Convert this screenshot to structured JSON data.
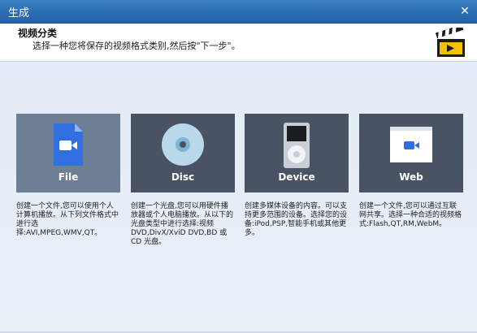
{
  "window": {
    "title": "生成",
    "close_glyph": "✕"
  },
  "header": {
    "title": "视频分类",
    "description": "选择一种您将保存的视频格式类别,然后按\"下一步\"。",
    "logo_icon": "clapperboard-icon"
  },
  "options": [
    {
      "label": "File",
      "icon": "file-video-icon",
      "selected": true,
      "description": "创建一个文件,您可以使用个人计算机播放。从下列文件格式中进行选择:AVI,MPEG,WMV,QT。"
    },
    {
      "label": "Disc",
      "icon": "disc-icon",
      "selected": false,
      "description": "创建一个光盘,您可以用硬件播放器或个人电脑播放。从以下的光盘类型中进行选择:视频 DVD,DivX/XviD DVD,BD 或 CD 光盘。"
    },
    {
      "label": "Device",
      "icon": "media-player-icon",
      "selected": false,
      "description": "创建多媒体设备的内容。可以支持更多范围的设备。选择您的设备:iPod,PSP,智能手机或其他更多。"
    },
    {
      "label": "Web",
      "icon": "web-video-icon",
      "selected": false,
      "description": "创建一个文件,您可以通过互联网共享。选择一种合适的视频格式:Flash,QT,RM,WebM。"
    }
  ],
  "colors": {
    "accent": "#2a6bb0",
    "tile": "#4a5363",
    "tile_selected": "#6c7f95"
  }
}
